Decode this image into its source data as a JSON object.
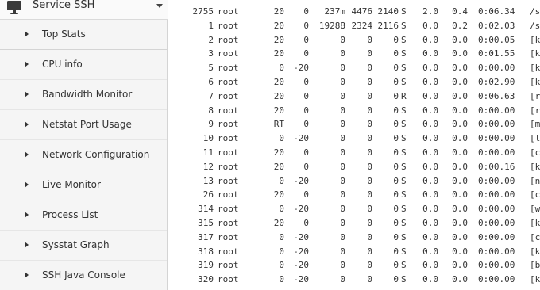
{
  "sidebar": {
    "header_title": "Service SSH",
    "items": [
      {
        "label": "Top Stats"
      },
      {
        "label": "CPU info"
      },
      {
        "label": "Bandwidth Monitor"
      },
      {
        "label": "Netstat Port Usage"
      },
      {
        "label": "Network Configuration"
      },
      {
        "label": "Live Monitor"
      },
      {
        "label": "Process List"
      },
      {
        "label": "Sysstat Graph"
      },
      {
        "label": "SSH Java Console"
      }
    ]
  },
  "processes": [
    {
      "pid": "2755",
      "user": "root",
      "pr": "20",
      "ni": "0",
      "virt": "237m",
      "res": "4476",
      "shr": "2140",
      "s": "S",
      "cpu": "2.0",
      "mem": "0.4",
      "time": "0:06.34",
      "cmd": "/s"
    },
    {
      "pid": "1",
      "user": "root",
      "pr": "20",
      "ni": "0",
      "virt": "19288",
      "res": "2324",
      "shr": "2116",
      "s": "S",
      "cpu": "0.0",
      "mem": "0.2",
      "time": "0:02.03",
      "cmd": "/s"
    },
    {
      "pid": "2",
      "user": "root",
      "pr": "20",
      "ni": "0",
      "virt": "0",
      "res": "0",
      "shr": "0",
      "s": "S",
      "cpu": "0.0",
      "mem": "0.0",
      "time": "0:00.05",
      "cmd": "[k"
    },
    {
      "pid": "3",
      "user": "root",
      "pr": "20",
      "ni": "0",
      "virt": "0",
      "res": "0",
      "shr": "0",
      "s": "S",
      "cpu": "0.0",
      "mem": "0.0",
      "time": "0:01.55",
      "cmd": "[k"
    },
    {
      "pid": "5",
      "user": "root",
      "pr": "0",
      "ni": "-20",
      "virt": "0",
      "res": "0",
      "shr": "0",
      "s": "S",
      "cpu": "0.0",
      "mem": "0.0",
      "time": "0:00.00",
      "cmd": "[k"
    },
    {
      "pid": "6",
      "user": "root",
      "pr": "20",
      "ni": "0",
      "virt": "0",
      "res": "0",
      "shr": "0",
      "s": "S",
      "cpu": "0.0",
      "mem": "0.0",
      "time": "0:02.90",
      "cmd": "[k"
    },
    {
      "pid": "7",
      "user": "root",
      "pr": "20",
      "ni": "0",
      "virt": "0",
      "res": "0",
      "shr": "0",
      "s": "R",
      "cpu": "0.0",
      "mem": "0.0",
      "time": "0:06.63",
      "cmd": "[r"
    },
    {
      "pid": "8",
      "user": "root",
      "pr": "20",
      "ni": "0",
      "virt": "0",
      "res": "0",
      "shr": "0",
      "s": "S",
      "cpu": "0.0",
      "mem": "0.0",
      "time": "0:00.00",
      "cmd": "[r"
    },
    {
      "pid": "9",
      "user": "root",
      "pr": "RT",
      "ni": "0",
      "virt": "0",
      "res": "0",
      "shr": "0",
      "s": "S",
      "cpu": "0.0",
      "mem": "0.0",
      "time": "0:00.00",
      "cmd": "[m"
    },
    {
      "pid": "10",
      "user": "root",
      "pr": "0",
      "ni": "-20",
      "virt": "0",
      "res": "0",
      "shr": "0",
      "s": "S",
      "cpu": "0.0",
      "mem": "0.0",
      "time": "0:00.00",
      "cmd": "[l"
    },
    {
      "pid": "11",
      "user": "root",
      "pr": "20",
      "ni": "0",
      "virt": "0",
      "res": "0",
      "shr": "0",
      "s": "S",
      "cpu": "0.0",
      "mem": "0.0",
      "time": "0:00.00",
      "cmd": "[c"
    },
    {
      "pid": "12",
      "user": "root",
      "pr": "20",
      "ni": "0",
      "virt": "0",
      "res": "0",
      "shr": "0",
      "s": "S",
      "cpu": "0.0",
      "mem": "0.0",
      "time": "0:00.16",
      "cmd": "[k"
    },
    {
      "pid": "13",
      "user": "root",
      "pr": "0",
      "ni": "-20",
      "virt": "0",
      "res": "0",
      "shr": "0",
      "s": "S",
      "cpu": "0.0",
      "mem": "0.0",
      "time": "0:00.00",
      "cmd": "[n"
    },
    {
      "pid": "26",
      "user": "root",
      "pr": "20",
      "ni": "0",
      "virt": "0",
      "res": "0",
      "shr": "0",
      "s": "S",
      "cpu": "0.0",
      "mem": "0.0",
      "time": "0:00.00",
      "cmd": "[c"
    },
    {
      "pid": "314",
      "user": "root",
      "pr": "0",
      "ni": "-20",
      "virt": "0",
      "res": "0",
      "shr": "0",
      "s": "S",
      "cpu": "0.0",
      "mem": "0.0",
      "time": "0:00.00",
      "cmd": "[w"
    },
    {
      "pid": "315",
      "user": "root",
      "pr": "20",
      "ni": "0",
      "virt": "0",
      "res": "0",
      "shr": "0",
      "s": "S",
      "cpu": "0.0",
      "mem": "0.0",
      "time": "0:00.00",
      "cmd": "[k"
    },
    {
      "pid": "317",
      "user": "root",
      "pr": "0",
      "ni": "-20",
      "virt": "0",
      "res": "0",
      "shr": "0",
      "s": "S",
      "cpu": "0.0",
      "mem": "0.0",
      "time": "0:00.00",
      "cmd": "[c"
    },
    {
      "pid": "318",
      "user": "root",
      "pr": "0",
      "ni": "-20",
      "virt": "0",
      "res": "0",
      "shr": "0",
      "s": "S",
      "cpu": "0.0",
      "mem": "0.0",
      "time": "0:00.00",
      "cmd": "[k"
    },
    {
      "pid": "319",
      "user": "root",
      "pr": "0",
      "ni": "-20",
      "virt": "0",
      "res": "0",
      "shr": "0",
      "s": "S",
      "cpu": "0.0",
      "mem": "0.0",
      "time": "0:00.00",
      "cmd": "[b"
    },
    {
      "pid": "320",
      "user": "root",
      "pr": "0",
      "ni": "-20",
      "virt": "0",
      "res": "0",
      "shr": "0",
      "s": "S",
      "cpu": "0.0",
      "mem": "0.0",
      "time": "0:00.00",
      "cmd": "[k"
    }
  ]
}
